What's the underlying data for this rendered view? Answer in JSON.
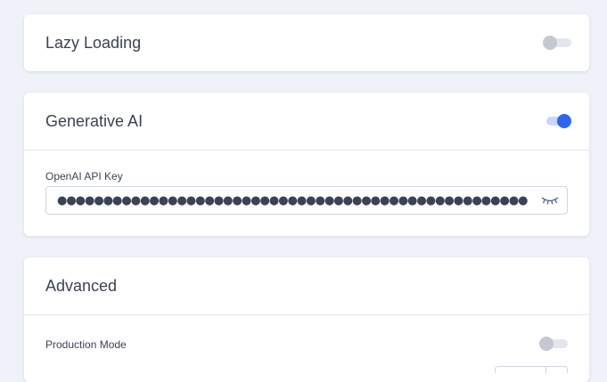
{
  "lazy_loading": {
    "title": "Lazy Loading",
    "enabled": false
  },
  "generative_ai": {
    "title": "Generative AI",
    "enabled": true,
    "api_key_label": "OpenAI API Key",
    "api_key_value": "●●●●●●●●●●●●●●●●●●●●●●●●●●●●●●●●●●●●●●●●●●●●●●●●●●●",
    "visibility_icon": "eye-closed-icon"
  },
  "advanced": {
    "title": "Advanced",
    "production_mode_label": "Production Mode",
    "production_mode_enabled": false
  },
  "colors": {
    "accent": "#2f64f0",
    "background": "#eff2f9"
  }
}
